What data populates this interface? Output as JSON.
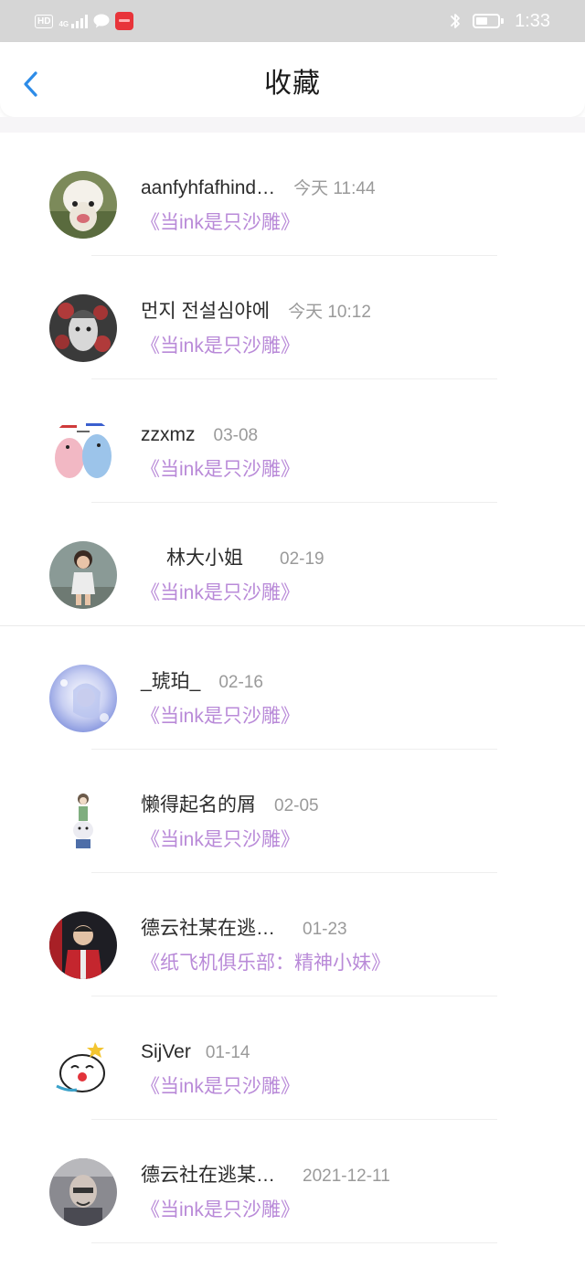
{
  "status_bar": {
    "hd": "HD",
    "network": "4G",
    "time": "1:33",
    "battery_level": 0.55,
    "icons": [
      "hd-icon",
      "signal-icon",
      "message-icon",
      "app-notification-icon",
      "bluetooth-icon",
      "battery-icon"
    ]
  },
  "header": {
    "title": "收藏",
    "back_icon": "chevron-left-icon",
    "accent_color": "#2d8ce8"
  },
  "colors": {
    "story_title": "#b98ad8",
    "time": "#9a9a9a",
    "name": "#2b2b2b"
  },
  "favorites": [
    {
      "name": "aanfyhfafhind…",
      "time": "今天 11:44",
      "title": "《当ink是只沙雕》"
    },
    {
      "name": "먼지 전설심야에",
      "time": "今天 10:12",
      "title": "《当ink是只沙雕》"
    },
    {
      "name": "zzxmz",
      "time": "03-08",
      "title": "《当ink是只沙雕》"
    },
    {
      "name": "林大小姐",
      "time": "02-19",
      "title": "《当ink是只沙雕》"
    },
    {
      "name": "_琥珀_",
      "time": "02-16",
      "title": "《当ink是只沙雕》"
    },
    {
      "name": "懒得起名的屑",
      "time": "02-05",
      "title": "《当ink是只沙雕》"
    },
    {
      "name": "德云社某在逃…",
      "time": "01-23",
      "title": "《纸飞机俱乐部：精神小妹》"
    },
    {
      "name": "SijVer",
      "time": "01-14",
      "title": "《当ink是只沙雕》"
    },
    {
      "name": "德云社在逃某…",
      "time": "2021-12-11",
      "title": "《当ink是只沙雕》"
    }
  ]
}
